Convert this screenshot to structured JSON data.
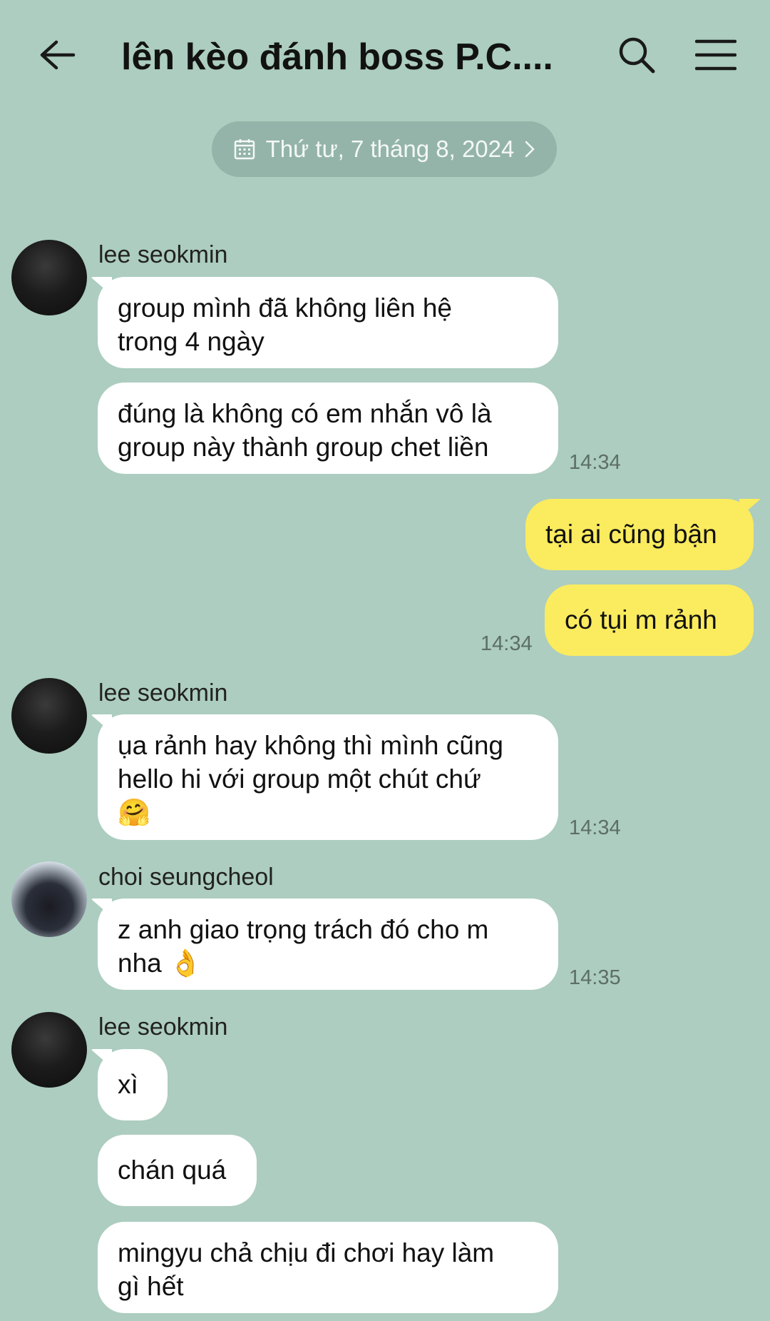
{
  "header": {
    "title": "lên kèo đánh boss P.C....",
    "back_icon": "arrow-left-icon",
    "search_icon": "search-icon",
    "menu_icon": "hamburger-menu-icon"
  },
  "date_separator": {
    "label": "Thứ tư, 7 tháng 8, 2024",
    "icon": "calendar-icon",
    "chevron": "chevron-right-icon"
  },
  "messages": [
    {
      "sender": "lee seokmin",
      "text_lines": [
        "group mình đã không liên hệ",
        "trong 4 ngày"
      ]
    },
    {
      "sender": "lee seokmin",
      "text_lines": [
        "đúng là không có em nhắn vô là",
        "group này thành group chet liền"
      ],
      "time": "14:34"
    },
    {
      "sender": "me",
      "text": "tại ai cũng bận"
    },
    {
      "sender": "me",
      "text": "có tụi m rảnh",
      "time": "14:34"
    },
    {
      "sender": "lee seokmin",
      "text_lines": [
        "ụa rảnh hay không thì mình cũng",
        "hello hi với group một chút chứ",
        "🤗"
      ],
      "time": "14:34"
    },
    {
      "sender": "choi seungcheol",
      "text_lines": [
        "z anh giao trọng trách đó cho m",
        "nha 👌"
      ],
      "time": "14:35"
    },
    {
      "sender": "lee seokmin",
      "text": "xì"
    },
    {
      "sender": "lee seokmin",
      "text": "chán quá"
    },
    {
      "sender": "lee seokmin",
      "text_lines": [
        "mingyu chả chịu đi chơi hay làm",
        "gì hết"
      ]
    }
  ],
  "colors": {
    "background": "#accdc0",
    "incoming_bubble": "#ffffff",
    "outgoing_bubble": "#fbeb5e"
  }
}
